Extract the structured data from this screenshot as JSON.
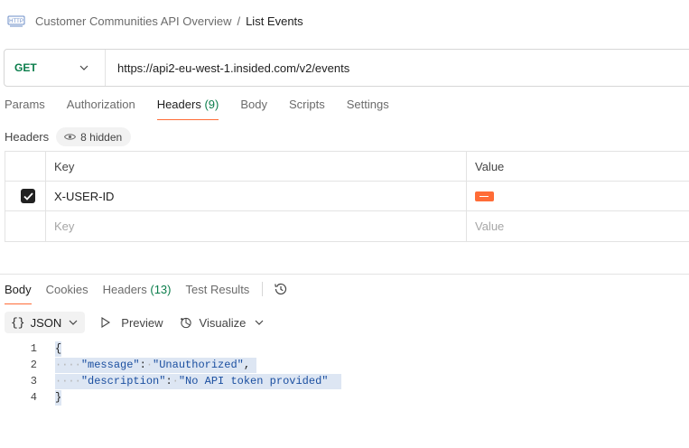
{
  "breadcrumb": {
    "icon": "http-icon",
    "parent": "Customer Communities API Overview",
    "separator": "/",
    "current": "List Events"
  },
  "request": {
    "method": "GET",
    "url": "https://api2-eu-west-1.insided.com/v2/events",
    "method_color": "#0a7d4b"
  },
  "request_tabs": [
    {
      "label": "Params"
    },
    {
      "label": "Authorization"
    },
    {
      "label": "Headers",
      "count": "(9)",
      "active": true
    },
    {
      "label": "Body"
    },
    {
      "label": "Scripts"
    },
    {
      "label": "Settings"
    }
  ],
  "headers_section": {
    "title": "Headers",
    "hidden_label": "8 hidden"
  },
  "headers_table": {
    "columns": [
      "Key",
      "Value"
    ],
    "rows": [
      {
        "checked": true,
        "key": "X-USER-ID",
        "value_redacted": true
      }
    ],
    "placeholder_key": "Key",
    "placeholder_value": "Value"
  },
  "response_tabs": [
    {
      "label": "Body",
      "active": true
    },
    {
      "label": "Cookies"
    },
    {
      "label": "Headers",
      "count": "(13)"
    },
    {
      "label": "Test Results"
    }
  ],
  "response_toolbar": {
    "format_icon": "{}",
    "format": "JSON",
    "preview": "Preview",
    "visualize": "Visualize"
  },
  "response_body": {
    "lines": [
      {
        "n": "1",
        "text": "{"
      },
      {
        "n": "2",
        "key": "\"message\"",
        "value": "\"Unauthorized\""
      },
      {
        "n": "3",
        "key": "\"description\"",
        "value": "\"No API token provided\""
      },
      {
        "n": "4",
        "text": "}"
      }
    ]
  },
  "colors": {
    "accent": "#ff6c37",
    "selection": "#dde6f3",
    "string": "#1b4fa0"
  }
}
